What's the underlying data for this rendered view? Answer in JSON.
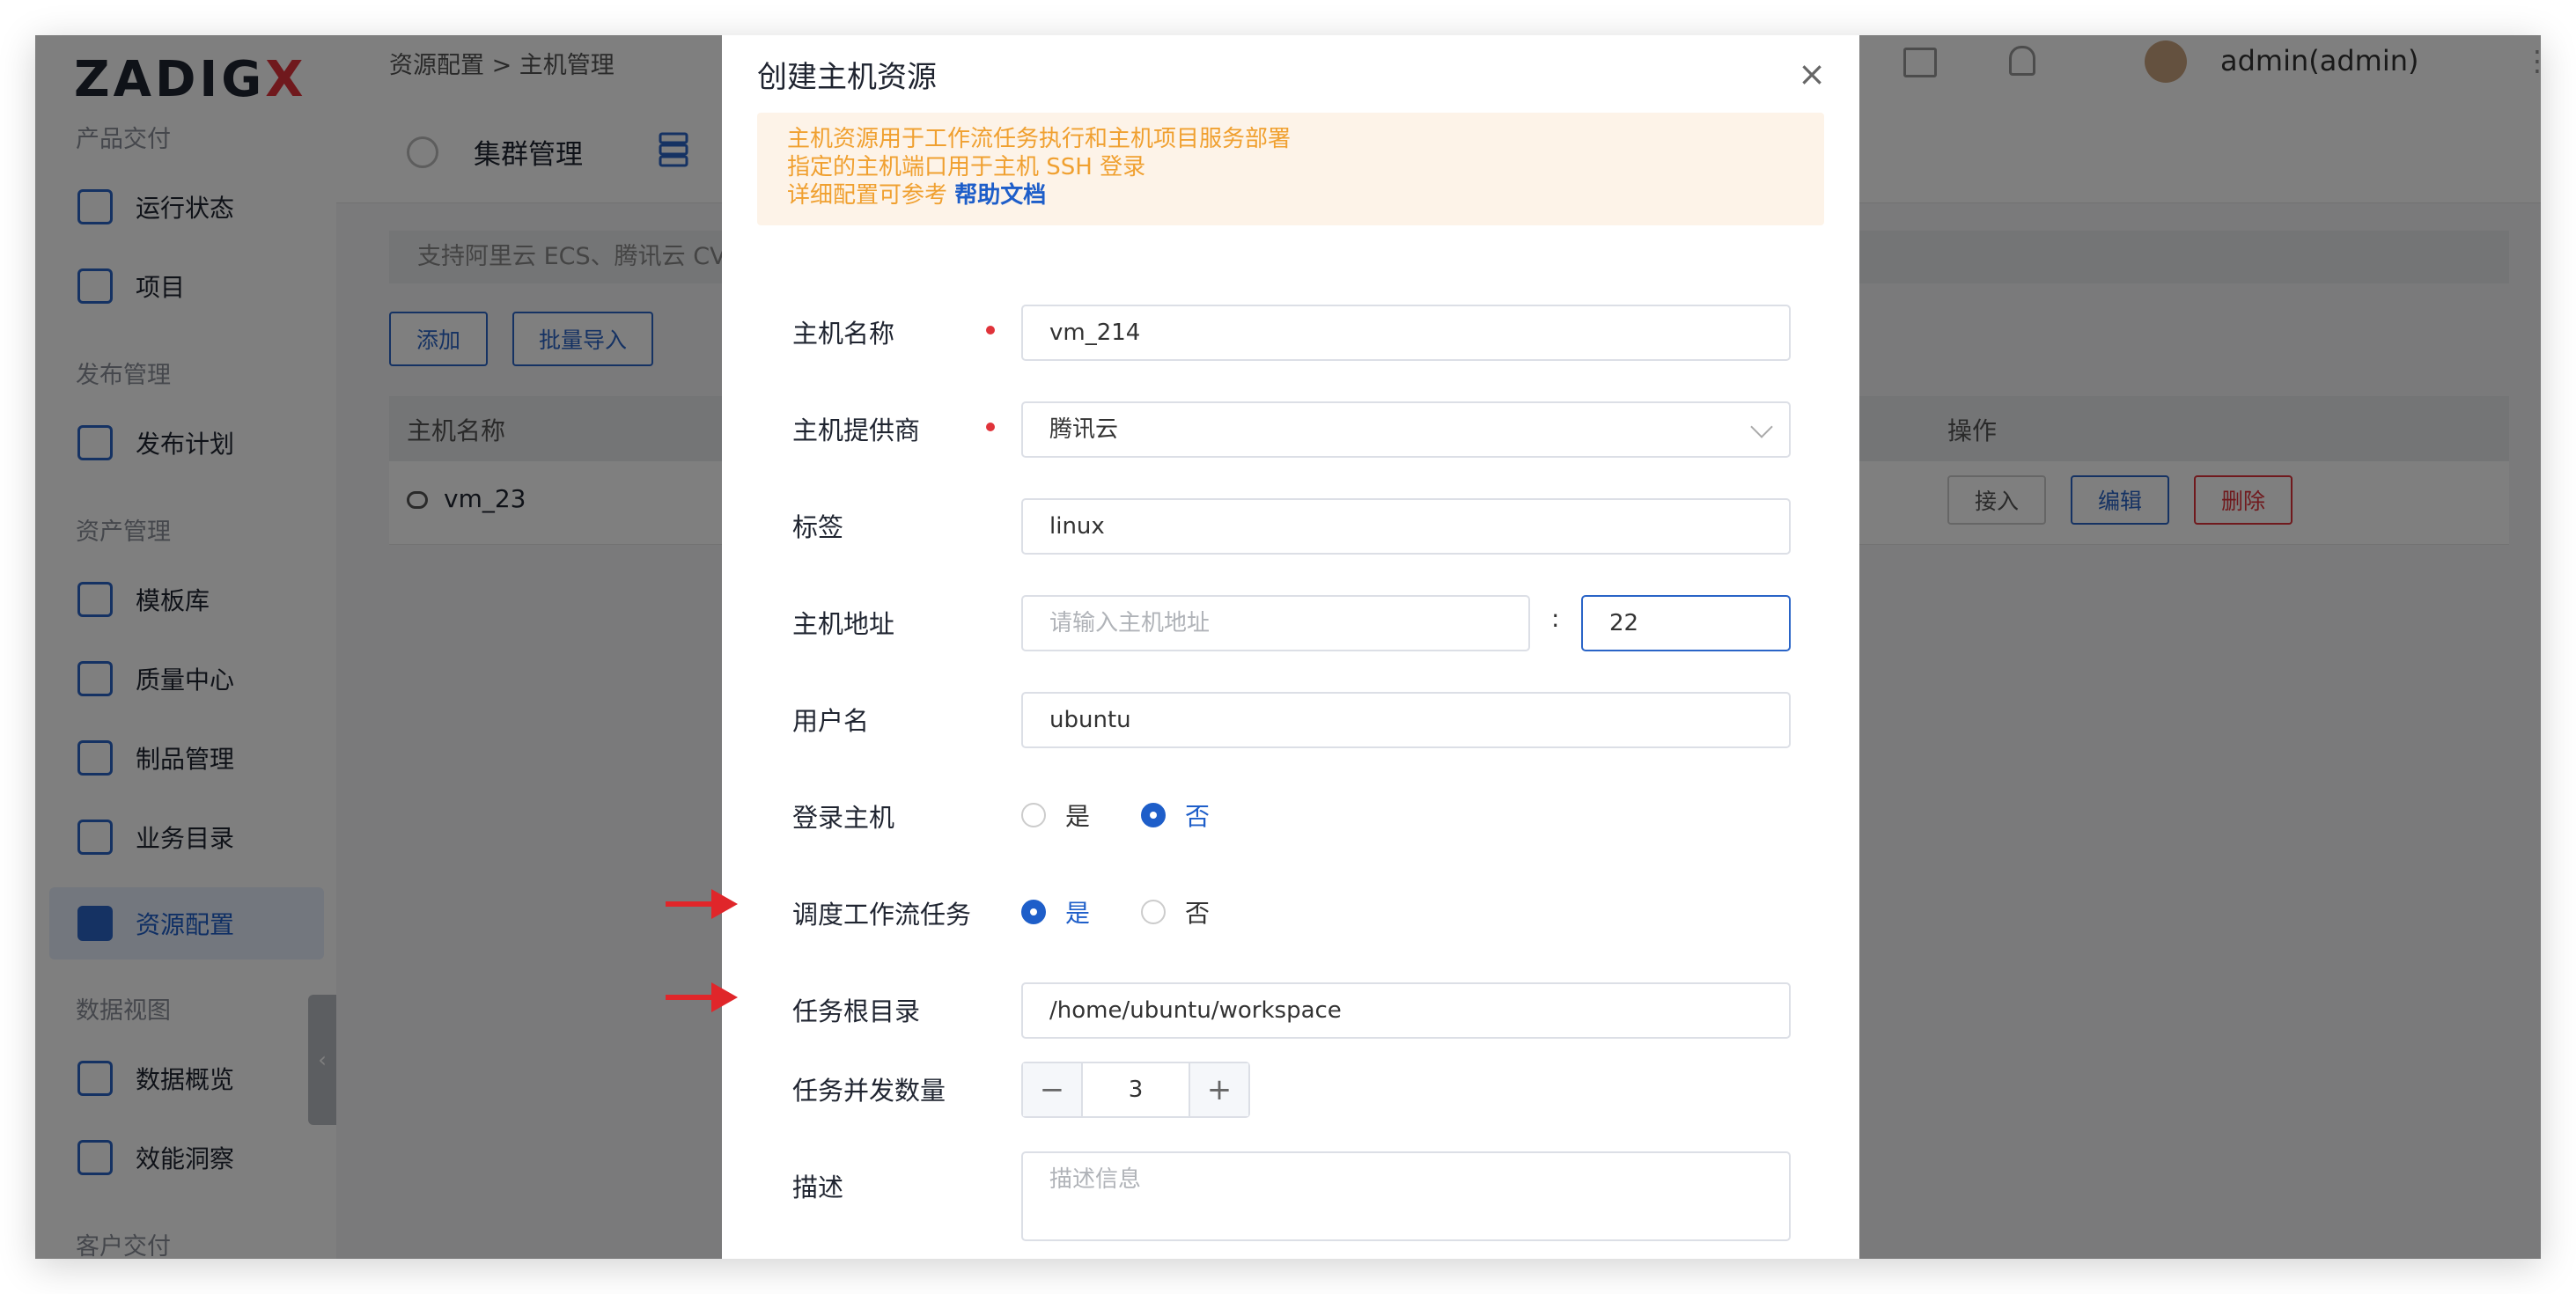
{
  "app": {
    "logo_text": "ZADIG",
    "logo_x": "X"
  },
  "sidebar": {
    "sections": [
      "产品交付",
      "发布管理",
      "资产管理",
      "数据视图",
      "客户交付"
    ],
    "items": [
      {
        "label": "运行状态",
        "icon": "pulse-icon"
      },
      {
        "label": "项目",
        "icon": "project-icon"
      },
      {
        "label": "发布计划",
        "icon": "edit-icon"
      },
      {
        "label": "模板库",
        "icon": "template-icon"
      },
      {
        "label": "质量中心",
        "icon": "flask-icon"
      },
      {
        "label": "制品管理",
        "icon": "package-icon"
      },
      {
        "label": "业务目录",
        "icon": "directory-icon"
      },
      {
        "label": "资源配置",
        "icon": "settings-icon"
      },
      {
        "label": "数据概览",
        "icon": "dashboard-icon"
      },
      {
        "label": "效能洞察",
        "icon": "pie-chart-icon"
      }
    ],
    "collapse": "‹"
  },
  "header": {
    "breadcrumb": "资源配置   >  主机管理",
    "user": "admin(admin)",
    "more": "⋮"
  },
  "tabs": {
    "cluster": "集群管理"
  },
  "page": {
    "support_text": "支持阿里云 ECS、腾讯云 CV",
    "add_button": "添加",
    "batch_import_button": "批量导入",
    "table": {
      "col_name": "主机名称",
      "col_ops": "操作",
      "rows": [
        {
          "name": "vm_23",
          "connect": "接入",
          "edit": "编辑",
          "delete": "删除"
        }
      ]
    }
  },
  "modal": {
    "title": "创建主机资源",
    "close": "×",
    "notice_line1": "主机资源用于工作流任务执行和主机项目服务部署",
    "notice_line2": "指定的主机端口用于主机 SSH 登录",
    "notice_line3_prefix": "详细配置可参考",
    "notice_link": "帮助文档",
    "fields": {
      "name_label": "主机名称",
      "name_value": "vm_214",
      "provider_label": "主机提供商",
      "provider_value": "腾讯云",
      "tag_label": "标签",
      "tag_value": "linux",
      "address_label": "主机地址",
      "address_placeholder": "请输入主机地址",
      "colon": ":",
      "port_value": "22",
      "user_label": "用户名",
      "user_value": "ubuntu",
      "login_label": "登录主机",
      "login_yes": "是",
      "login_no": "否",
      "login_selected": "否",
      "schedule_label": "调度工作流任务",
      "schedule_yes": "是",
      "schedule_no": "否",
      "schedule_selected": "是",
      "workdir_label": "任务根目录",
      "workdir_value": "/home/ubuntu/workspace",
      "concurrency_label": "任务并发数量",
      "concurrency_value": "3",
      "minus": "−",
      "plus": "+",
      "desc_label": "描述",
      "desc_placeholder": "描述信息"
    }
  },
  "colors": {
    "accent": "#1e5ec9",
    "danger": "#e0333a",
    "notice": "#f0a030",
    "arrow": "#e0262a"
  }
}
